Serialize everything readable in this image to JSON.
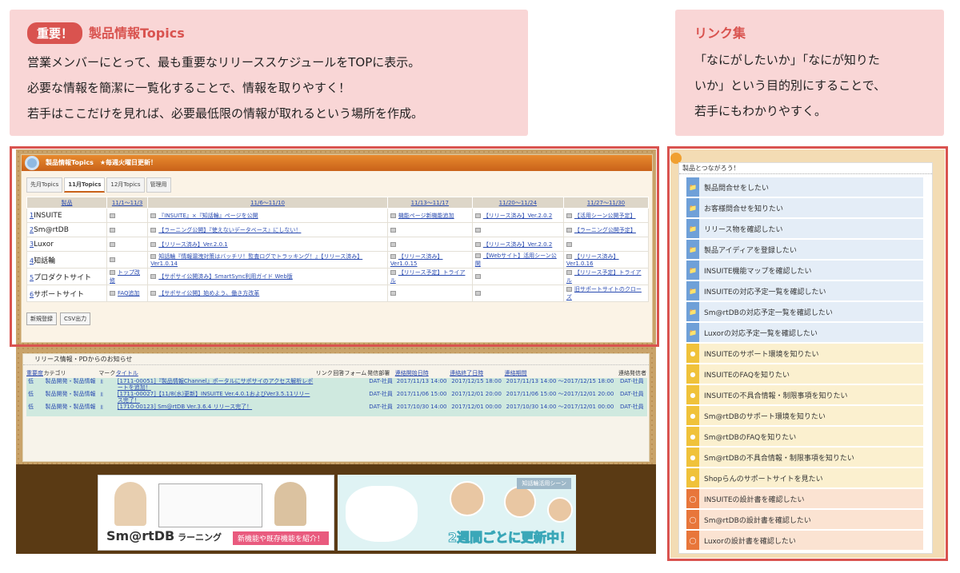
{
  "callout_left": {
    "badge": "重要！",
    "title": "製品情報Topics",
    "lines": [
      "営業メンバーにとって、最も重要なリリーススケジュールをTOPに表示。",
      "必要な情報を簡潔に一覧化することで、情報を取りやすく！",
      "若手はここだけを見れば、必要最低限の情報が取れるという場所を作成。"
    ]
  },
  "callout_right": {
    "title": "リンク集",
    "lines": [
      "「なにがしたいか」「なにが知りた",
      "いか」という目的別にすることで、",
      "若手にもわかりやすく。"
    ]
  },
  "topics": {
    "header": "製品情報Topics　★毎週火曜日更新！",
    "tabs": [
      "先月Topics",
      "11月Topics",
      "12月Topics",
      "管理用"
    ],
    "columns": [
      "製品",
      "11/1～11/3",
      "11/6～11/10",
      "11/13～11/17",
      "11/20～11/24",
      "11/27～11/30"
    ],
    "rows": [
      {
        "num": "1",
        "name": "INSUITE",
        "cells": [
          "",
          "『INSUITE』×『知話輪』ページを公開",
          "機能ページ新機能追加",
          "【リリース済み】Ver.2.0.2",
          "【活用シーン公開予定】"
        ]
      },
      {
        "num": "2",
        "name": "Sm@rtDB",
        "cells": [
          "",
          "【ラーニング公開】『使えないデータベース』にしない！",
          "",
          "",
          "【ラーニング公開予定】"
        ]
      },
      {
        "num": "3",
        "name": "Luxor",
        "cells": [
          "",
          "【リリース済み】Ver.2.0.1",
          "",
          "【リリース済み】Ver.2.0.2",
          ""
        ]
      },
      {
        "num": "4",
        "name": "知話輪",
        "cells": [
          "",
          "知話輪『情報漏洩対策はバッチリ！監査ログでトラッキング！』【リリース済み】Ver1.0.14",
          "【リリース済み】Ver1.0.15",
          "【Webサイト】活用シーン公開",
          "【リリース済み】Ver1.0.16"
        ]
      },
      {
        "num": "5",
        "name": "プロダクトサイト",
        "cells": [
          "トップ改修",
          "【サポサイ公開済み】SmartSync利用ガイド Web版",
          "【リリース予定】トライアル",
          "",
          "【リリース予定】トライアル"
        ]
      },
      {
        "num": "6",
        "name": "サポートサイト",
        "cells": [
          "FAQ追加",
          "【サポサイ公開】始めよう、働き方改革",
          "",
          "",
          "旧サポートサイトのクローズ"
        ]
      }
    ],
    "buttons": [
      "新規登録",
      "CSV出力"
    ]
  },
  "release": {
    "header": "リリース情報・PDからのお知らせ",
    "columns": [
      "重要度",
      "カテゴリ",
      "マーク",
      "タイトル",
      "リンク",
      "回答フォーム",
      "発信部署",
      "連絡開始日時",
      "連絡終了日時",
      "連絡期間",
      "連絡発信者"
    ],
    "rows": [
      {
        "imp": "低",
        "cat": "製品開発・製品情報",
        "title": "[1711-00051]『製品情報Channel』ポータルにサポサイのアクセス解析レポートを追加！",
        "dept": "DAT-社員",
        "start": "2017/11/13 14:00",
        "end": "2017/12/15 18:00",
        "period": "2017/11/13 14:00 ～2017/12/15 18:00",
        "sender": "DAT-社員"
      },
      {
        "imp": "低",
        "cat": "製品開発・製品情報",
        "title": "[1711-00027]【11/8(水)更新】INSUITE Ver.4.0.1およびVer3.5.11リリース完了！",
        "dept": "DAT-社員",
        "start": "2017/11/06 15:00",
        "end": "2017/12/01 20:00",
        "period": "2017/11/06 15:00 ～2017/12/01 20:00",
        "sender": "DAT-社員"
      },
      {
        "imp": "低",
        "cat": "製品開発・製品情報",
        "title": "[1710-00123] Sm@rtDB Ver.3.6.4 リリース完了！",
        "dept": "DAT-社員",
        "start": "2017/10/30 14:00",
        "end": "2017/12/01 00:00",
        "period": "2017/10/30 14:00 ～2017/12/01 00:00",
        "sender": "DAT-社員"
      }
    ]
  },
  "banner1": {
    "logo": "Sm@rtDB",
    "logo2": "ラーニング",
    "tag": "新機能や既存機能を紹介！"
  },
  "banner2": {
    "tag": "知話輪活用シーン",
    "big": "2週間ごとに更新中！"
  },
  "links": {
    "header": "製品とつながろう！",
    "items": [
      {
        "label": "製品問合せをしたい",
        "kind": "blue"
      },
      {
        "label": "お客様問合せを知りたい",
        "kind": "blue"
      },
      {
        "label": "リリース物を確認したい",
        "kind": "blue"
      },
      {
        "label": "製品アイディアを登録したい",
        "kind": "blue"
      },
      {
        "label": "INSUITE機能マップを確認したい",
        "kind": "blue"
      },
      {
        "label": "INSUITEの対応予定一覧を確認したい",
        "kind": "blue"
      },
      {
        "label": "Sm@rtDBの対応予定一覧を確認したい",
        "kind": "blue"
      },
      {
        "label": "Luxorの対応予定一覧を確認したい",
        "kind": "blue"
      },
      {
        "label": "INSUITEのサポート環境を知りたい",
        "kind": "yel"
      },
      {
        "label": "INSUITEのFAQを知りたい",
        "kind": "yel"
      },
      {
        "label": "INSUITEの不具合情報・制限事項を知りたい",
        "kind": "yel"
      },
      {
        "label": "Sm@rtDBのサポート環境を知りたい",
        "kind": "yel"
      },
      {
        "label": "Sm@rtDBのFAQを知りたい",
        "kind": "yel"
      },
      {
        "label": "Sm@rtDBの不具合情報・制限事項を知りたい",
        "kind": "yel"
      },
      {
        "label": "Shopらんのサポートサイトを見たい",
        "kind": "yel"
      },
      {
        "label": "INSUITEの設計書を確認したい",
        "kind": "org"
      },
      {
        "label": "Sm@rtDBの設計書を確認したい",
        "kind": "org"
      },
      {
        "label": "Luxorの設計書を確認したい",
        "kind": "org"
      }
    ]
  }
}
